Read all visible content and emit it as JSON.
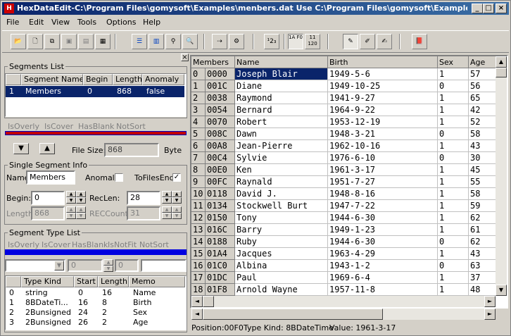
{
  "window": {
    "title": "HexDataEdit-C:\\Program Files\\gomysoft\\Examples\\menbers.dat Use C:\\Program Files\\gomysoft\\Examples\\me...",
    "min_glyph": "_",
    "max_glyph": "□",
    "close_glyph": "×"
  },
  "menu": [
    "File",
    "Edit",
    "View",
    "Tools",
    "Options",
    "Help"
  ],
  "toolbar": {
    "num_label": "¹2₃",
    "hex_label": "1A F0",
    "bin_label": "11 120"
  },
  "segments_list": {
    "title": "Segments List",
    "headers": [
      "Segment Name",
      "Begin",
      "Length",
      "Anomaly"
    ],
    "rows": [
      {
        "idx": "1",
        "name": "Members",
        "begin": "0",
        "length": "868",
        "anomaly": "false"
      }
    ],
    "flags": [
      "IsOverly",
      "IsCover",
      "HasBlank",
      "NotSort"
    ]
  },
  "file_size": {
    "label": "File Size:",
    "value": "868",
    "unit": "Byte"
  },
  "single_segment": {
    "title": "Single Segment Info",
    "name_label": "Name:",
    "name_value": "Members",
    "anomaly_label": "Anomaly",
    "anomaly_checked": false,
    "tofilesend_label": "ToFilesEnd",
    "tofilesend_checked": true,
    "begin_label": "Begin:",
    "begin_value": "0",
    "reclen_label": "RecLen:",
    "reclen_value": "28",
    "length_label": "Length:",
    "length_value": "868",
    "reccount_label": "RECCount:",
    "reccount_value": "31"
  },
  "segment_type": {
    "title": "Segment Type List",
    "flags": [
      "IsOverly",
      "IsCover",
      "HasBlank",
      "IsNotFit",
      "NotSort"
    ],
    "input_a": "0",
    "input_b": "0",
    "headers": [
      "Type Kind",
      "Start",
      "Length",
      "Memo"
    ],
    "rows": [
      {
        "idx": "0",
        "kind": "string",
        "start": "0",
        "length": "16",
        "memo": "Name"
      },
      {
        "idx": "1",
        "kind": "8BDateTi...",
        "start": "16",
        "length": "8",
        "memo": "Birth"
      },
      {
        "idx": "2",
        "kind": "2Bunsigned",
        "start": "24",
        "length": "2",
        "memo": "Sex"
      },
      {
        "idx": "3",
        "kind": "2Bunsigned",
        "start": "26",
        "length": "2",
        "memo": "Age"
      }
    ]
  },
  "grid": {
    "headers": [
      "Members",
      "Name",
      "Birth",
      "Sex",
      "Age"
    ],
    "rows": [
      [
        "0",
        "0000",
        "Joseph Blair",
        "1949-5-6",
        "1",
        "57"
      ],
      [
        "1",
        "001C",
        "Diane",
        "1949-10-25",
        "0",
        "56"
      ],
      [
        "2",
        "0038",
        "Raymond",
        "1941-9-27",
        "1",
        "65"
      ],
      [
        "3",
        "0054",
        "Bernard",
        "1964-9-22",
        "1",
        "42"
      ],
      [
        "4",
        "0070",
        "Robert",
        "1953-12-19",
        "1",
        "52"
      ],
      [
        "5",
        "008C",
        "Dawn",
        "1948-3-21",
        "0",
        "58"
      ],
      [
        "6",
        "00A8",
        "Jean-Pierre",
        "1962-10-16",
        "1",
        "43"
      ],
      [
        "7",
        "00C4",
        "Sylvie",
        "1976-6-10",
        "0",
        "30"
      ],
      [
        "8",
        "00E0",
        "Ken",
        "1961-3-17",
        "1",
        "45"
      ],
      [
        "9",
        "00FC",
        "Raynald",
        "1951-7-27",
        "1",
        "55"
      ],
      [
        "10",
        "0118",
        "David J.",
        "1948-8-16",
        "1",
        "58"
      ],
      [
        "11",
        "0134",
        "Stockwell Burt",
        "1947-7-22",
        "1",
        "59"
      ],
      [
        "12",
        "0150",
        "Tony",
        "1944-6-30",
        "1",
        "62"
      ],
      [
        "13",
        "016C",
        "Barry",
        "1949-1-23",
        "1",
        "61"
      ],
      [
        "14",
        "0188",
        "Ruby",
        "1944-6-30",
        "0",
        "62"
      ],
      [
        "15",
        "01A4",
        "Jacques",
        "1963-4-29",
        "1",
        "43"
      ],
      [
        "16",
        "01C0",
        "Albina",
        "1943-1-2",
        "0",
        "63"
      ],
      [
        "17",
        "01DC",
        "Paul",
        "1969-6-4",
        "1",
        "37"
      ],
      [
        "18",
        "01F8",
        "Arnold Wayne",
        "1957-11-8",
        "1",
        "48"
      ]
    ]
  },
  "status": {
    "position": "Position:00F0",
    "type_kind": "Type Kind: 8BDateTime",
    "value": "Value: 1961-3-17"
  }
}
